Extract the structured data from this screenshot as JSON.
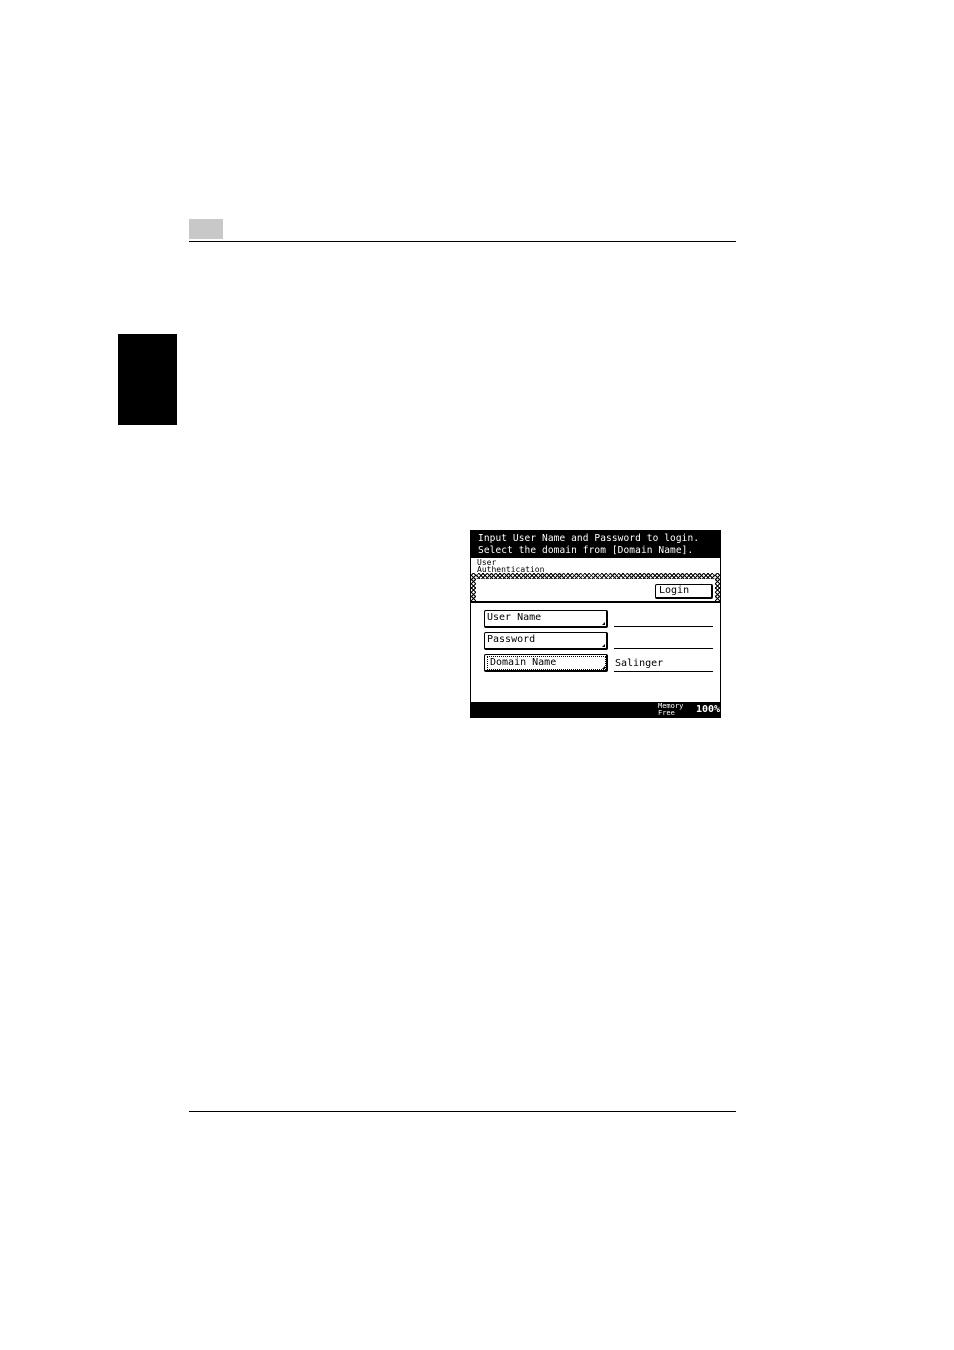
{
  "panel": {
    "message_line1": "Input User Name and Password to login.",
    "message_line2": "Select the domain from [Domain Name].",
    "mode_title_line1": "User",
    "mode_title_line2": "Authentication",
    "login_label": "Login",
    "fields": [
      {
        "label": "User Name",
        "value": ""
      },
      {
        "label": "Password",
        "value": ""
      },
      {
        "label": "Domain Name",
        "value": "Salinger"
      }
    ],
    "status": {
      "memory_label_line1": "Memory",
      "memory_label_line2": "Free",
      "memory_value": "100%"
    }
  }
}
